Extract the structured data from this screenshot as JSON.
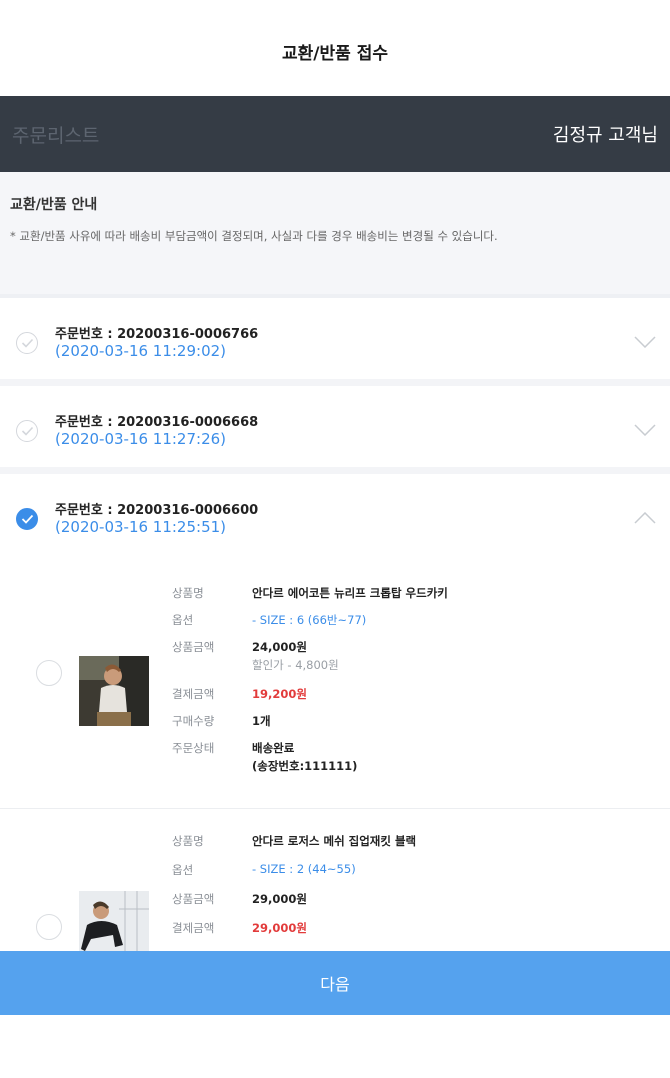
{
  "header": {
    "title": "교환/반품 접수"
  },
  "customer_bar": {
    "list_label": "주문리스트",
    "customer_name": "김정규 고객님"
  },
  "notice": {
    "title": "교환/반품 안내",
    "text": "* 교환/반품 사유에 따라 배송비 부담금액이 결정되며, 사실과 다를 경우 배송비는 변경될 수 있습니다."
  },
  "orders": [
    {
      "order_no": "주문번호 : 20200316-0006766",
      "date": "(2020-03-16 11:29:02)",
      "selected": false
    },
    {
      "order_no": "주문번호 : 20200316-0006668",
      "date": "(2020-03-16 11:27:26)",
      "selected": false
    },
    {
      "order_no": "주문번호 : 20200316-0006600",
      "date": "(2020-03-16 11:25:51)",
      "selected": true
    }
  ],
  "labels": {
    "product_name": "상품명",
    "option": "옵션",
    "product_price": "상품금액",
    "payment_amount": "결제금액",
    "quantity": "구매수량",
    "order_status": "주문상태"
  },
  "products": [
    {
      "name": "안다르 에어코튼 뉴리프 크롭탑 우드카키",
      "option": "- SIZE : 6 (66반~77)",
      "price": "24,000원",
      "discount": "할인가 - 4,800원",
      "payment": "19,200원",
      "quantity": "1개",
      "status": "배송완료",
      "tracking": "(송장번호:111111)"
    },
    {
      "name": "안다르 로저스 메쉬 집업재킷 블랙",
      "option": "- SIZE : 2 (44~55)",
      "price": "29,000원",
      "payment": "29,000원"
    }
  ],
  "footer": {
    "next_label": "다음"
  },
  "colors": {
    "accent": "#3b8de8",
    "button": "#55a2ee",
    "dark_bar": "#353c45",
    "price_red": "#e23b3b"
  }
}
